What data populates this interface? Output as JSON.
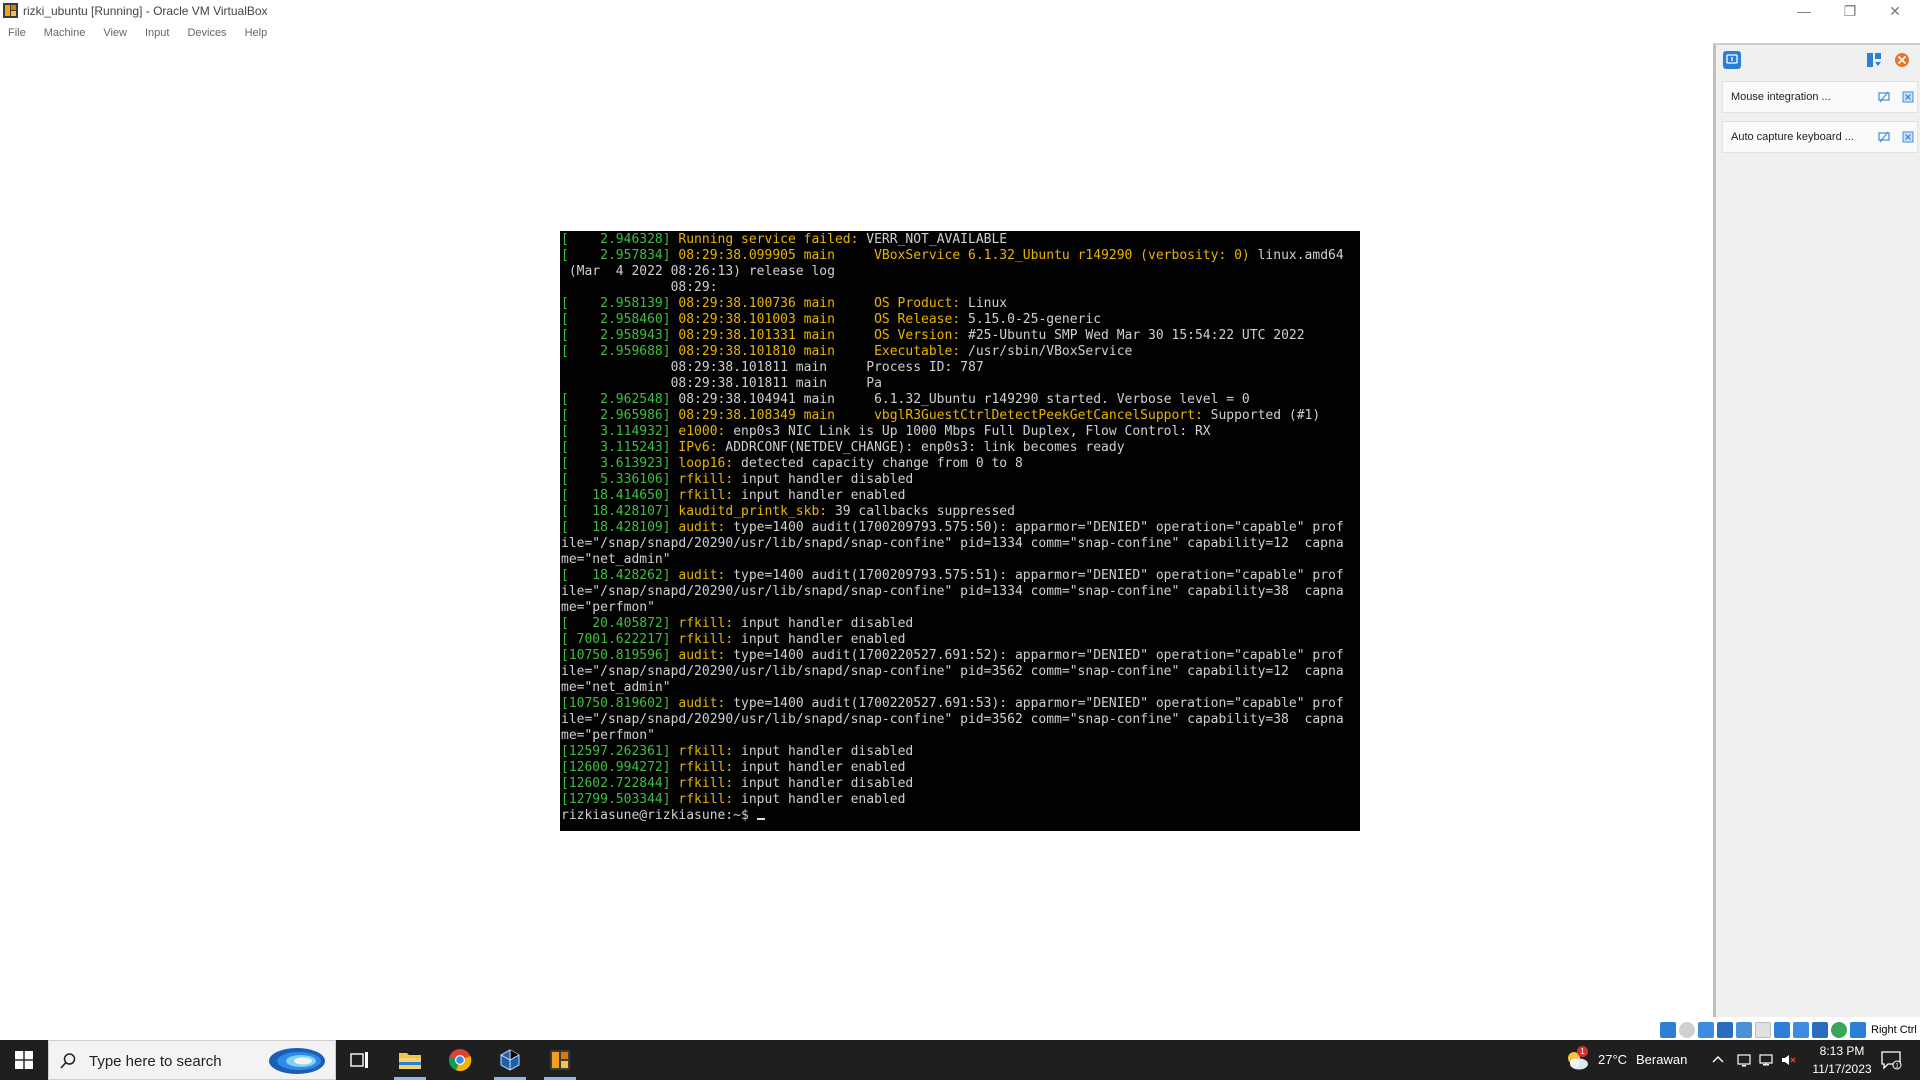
{
  "window": {
    "title": "rizki_ubuntu [Running] - Oracle VM VirtualBox",
    "controls": {
      "minimize": "—",
      "maximize": "❐",
      "close": "✕"
    }
  },
  "menu": [
    "File",
    "Machine",
    "View",
    "Input",
    "Devices",
    "Help"
  ],
  "console": [
    {
      "ts": "[    2.946328] ",
      "hl": "Running service failed:",
      "rest": " VERR_NOT_AVAILABLE"
    },
    {
      "ts": "[    2.957834] ",
      "hl": "08:29:38.099905 main     VBoxService 6.1.32_Ubuntu r149290 (verbosity: 0)",
      "rest": " linux.amd64"
    },
    {
      "ts": "",
      "hl": "",
      "rest": " (Mar  4 2022 08:26:13) release log"
    },
    {
      "ts": "",
      "hl": "",
      "rest": "              08:29:"
    },
    {
      "ts": "[    2.958139] ",
      "hl": "08:29:38.100736 main     OS Product:",
      "rest": " Linux"
    },
    {
      "ts": "[    2.958460] ",
      "hl": "08:29:38.101003 main     OS Release:",
      "rest": " 5.15.0-25-generic"
    },
    {
      "ts": "[    2.958943] ",
      "hl": "08:29:38.101331 main     OS Version:",
      "rest": " #25-Ubuntu SMP Wed Mar 30 15:54:22 UTC 2022"
    },
    {
      "ts": "[    2.959688] ",
      "hl": "08:29:38.101810 main     Executable:",
      "rest": " /usr/sbin/VBoxService"
    },
    {
      "ts": "",
      "hl": "",
      "rest": "              08:29:38.101811 main     Process ID: 787"
    },
    {
      "ts": "",
      "hl": "",
      "rest": "              08:29:38.101811 main     Pa"
    },
    {
      "ts": "[    2.962548] ",
      "hl": "",
      "rest": "08:29:38.104941 main     6.1.32_Ubuntu r149290 started. Verbose level = 0"
    },
    {
      "ts": "[    2.965986] ",
      "hl": "08:29:38.108349 main     vbglR3GuestCtrlDetectPeekGetCancelSupport:",
      "rest": " Supported (#1)"
    },
    {
      "ts": "[    3.114932] ",
      "hl": "e1000:",
      "rest": " enp0s3 NIC Link is Up 1000 Mbps Full Duplex, Flow Control: RX"
    },
    {
      "ts": "[    3.115243] ",
      "hl": "IPv6:",
      "rest": " ADDRCONF(NETDEV_CHANGE): enp0s3: link becomes ready"
    },
    {
      "ts": "[    3.613923] ",
      "hl": "loop16:",
      "rest": " detected capacity change from 0 to 8"
    },
    {
      "ts": "[    5.336106] ",
      "hl": "rfkill:",
      "rest": " input handler disabled"
    },
    {
      "ts": "[   18.414650] ",
      "hl": "rfkill:",
      "rest": " input handler enabled"
    },
    {
      "ts": "[   18.428107] ",
      "hl": "kauditd_printk_skb:",
      "rest": " 39 callbacks suppressed"
    },
    {
      "ts": "[   18.428109] ",
      "hl": "audit:",
      "rest": " type=1400 audit(1700209793.575:50): apparmor=\"DENIED\" operation=\"capable\" prof"
    },
    {
      "ts": "",
      "hl": "",
      "rest": "ile=\"/snap/snapd/20290/usr/lib/snapd/snap-confine\" pid=1334 comm=\"snap-confine\" capability=12  capna"
    },
    {
      "ts": "",
      "hl": "",
      "rest": "me=\"net_admin\""
    },
    {
      "ts": "[   18.428262] ",
      "hl": "audit:",
      "rest": " type=1400 audit(1700209793.575:51): apparmor=\"DENIED\" operation=\"capable\" prof"
    },
    {
      "ts": "",
      "hl": "",
      "rest": "ile=\"/snap/snapd/20290/usr/lib/snapd/snap-confine\" pid=1334 comm=\"snap-confine\" capability=38  capna"
    },
    {
      "ts": "",
      "hl": "",
      "rest": "me=\"perfmon\""
    },
    {
      "ts": "[   20.405872] ",
      "hl": "rfkill:",
      "rest": " input handler disabled"
    },
    {
      "ts": "[ 7001.622217] ",
      "hl": "rfkill:",
      "rest": " input handler enabled"
    },
    {
      "ts": "[10750.819596] ",
      "hl": "audit:",
      "rest": " type=1400 audit(1700220527.691:52): apparmor=\"DENIED\" operation=\"capable\" prof"
    },
    {
      "ts": "",
      "hl": "",
      "rest": "ile=\"/snap/snapd/20290/usr/lib/snapd/snap-confine\" pid=3562 comm=\"snap-confine\" capability=12  capna"
    },
    {
      "ts": "",
      "hl": "",
      "rest": "me=\"net_admin\""
    },
    {
      "ts": "[10750.819602] ",
      "hl": "audit:",
      "rest": " type=1400 audit(1700220527.691:53): apparmor=\"DENIED\" operation=\"capable\" prof"
    },
    {
      "ts": "",
      "hl": "",
      "rest": "ile=\"/snap/snapd/20290/usr/lib/snapd/snap-confine\" pid=3562 comm=\"snap-confine\" capability=38  capna"
    },
    {
      "ts": "",
      "hl": "",
      "rest": "me=\"perfmon\""
    },
    {
      "ts": "[12597.262361] ",
      "hl": "rfkill:",
      "rest": " input handler disabled"
    },
    {
      "ts": "[12600.994272] ",
      "hl": "rfkill:",
      "rest": " input handler enabled"
    },
    {
      "ts": "[12602.722844] ",
      "hl": "rfkill:",
      "rest": " input handler disabled"
    },
    {
      "ts": "[12799.503344] ",
      "hl": "rfkill:",
      "rest": " input handler enabled"
    }
  ],
  "prompt": "rizkiasune@rizkiasune:~$ ",
  "notifications": [
    {
      "text": "Mouse integration ..."
    },
    {
      "text": "Auto capture keyboard ..."
    }
  ],
  "statusbar": {
    "host_key": "Right Ctrl"
  },
  "taskbar": {
    "search_placeholder": "Type here to search",
    "apps": [
      "task-view",
      "file-explorer",
      "chrome",
      "virtualbox",
      "virtualbox-vm"
    ],
    "weather": {
      "temp": "27°C",
      "condition": "Berawan",
      "badge": "1"
    },
    "clock": {
      "time": "8:13 PM",
      "date": "11/17/2023"
    }
  },
  "colors": {
    "console_bg": "#020202",
    "console_text": "#cfcfcf",
    "timestamp": "#3fbf3f",
    "highlight": "#e8b400",
    "taskbar": "#1f1f1f"
  }
}
